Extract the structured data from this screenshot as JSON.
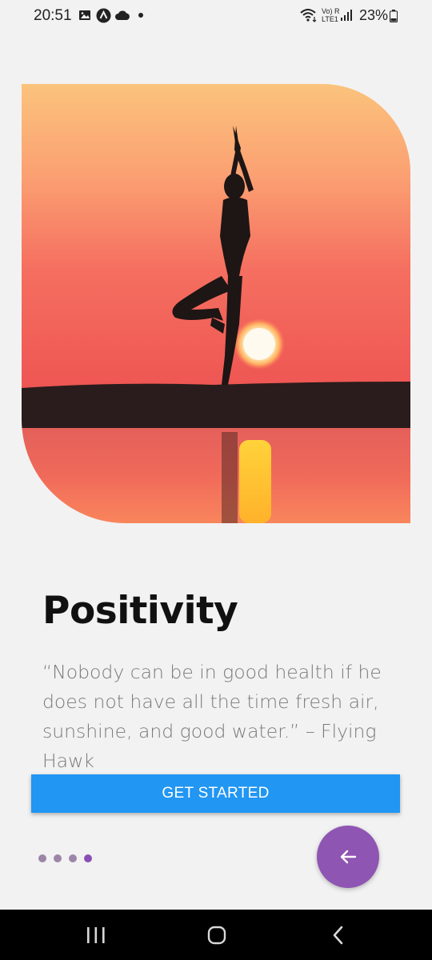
{
  "status_bar": {
    "time": "20:51",
    "battery": "23%",
    "network_label_top": "Vo) R",
    "network_label_bottom": "LTE1"
  },
  "onboarding": {
    "title": "Positivity",
    "quote": "“Nobody can be in good health if he does not have all the time fresh air, sunshine, and good water.” – Flying Hawk",
    "cta_label": "GET STARTED",
    "page_count": 4,
    "current_page": 4
  },
  "colors": {
    "cta": "#2196f3",
    "fab": "#8f55b3",
    "dot_active": "#8a4fb5",
    "dot_inactive": "#9c86a8"
  },
  "icons": {
    "fab": "arrow-left-icon",
    "nav_recents": "recents-icon",
    "nav_home": "home-icon",
    "nav_back": "back-icon"
  }
}
